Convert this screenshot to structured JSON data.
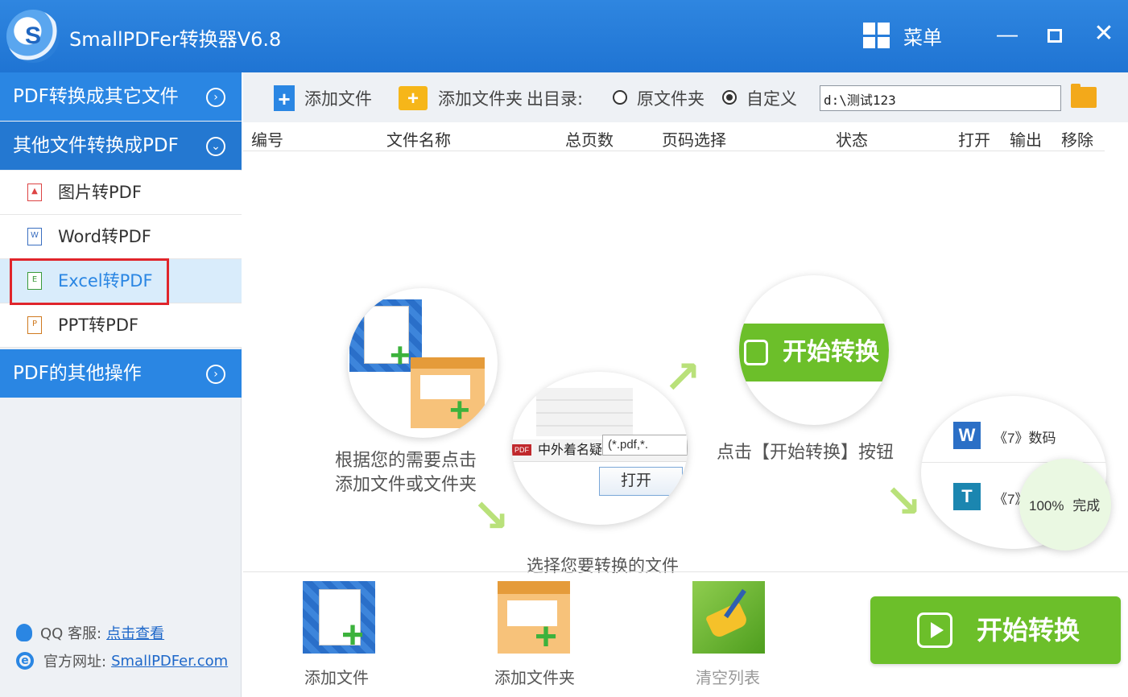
{
  "app": {
    "title": "SmallPDFer转换器V6.8",
    "menu_label": "菜单"
  },
  "window_controls": {
    "minimize": "—",
    "close": "✕"
  },
  "sidebar": {
    "sections": [
      {
        "label": "PDF转换成其它文件",
        "toggle": "›"
      },
      {
        "label": "其他文件转换成PDF",
        "toggle": "⌄"
      },
      {
        "label": "PDF的其他操作",
        "toggle": "›"
      }
    ],
    "items": [
      {
        "label": "图片转PDF",
        "icon": "image-file-icon"
      },
      {
        "label": "Word转PDF",
        "icon": "word-file-icon"
      },
      {
        "label": "Excel转PDF",
        "icon": "excel-file-icon"
      },
      {
        "label": "PPT转PDF",
        "icon": "ppt-file-icon"
      }
    ],
    "footer": {
      "qq_label": "QQ 客服:",
      "qq_link": "点击查看",
      "site_label": "官方网址:",
      "site_link": "SmallPDFer.com"
    }
  },
  "toolbar": {
    "add_file": "添加文件",
    "add_folder": "添加文件夹",
    "output_dir_label": "出目录:",
    "radio_original": "原文件夹",
    "radio_custom": "自定义",
    "output_path": "d:\\测试123"
  },
  "table": {
    "headers": [
      "编号",
      "文件名称",
      "总页数",
      "页码选择",
      "状态",
      "打开",
      "输出",
      "移除"
    ]
  },
  "guide": {
    "step1_line1": "根据您的需要点击",
    "step1_line2": "添加文件或文件夹",
    "step2": "选择您要转换的文件",
    "step3": "点击【开始转换】按钮",
    "dialog_file": "中外着名疑",
    "dialog_filter": "(*.pdf,*.",
    "dialog_open": "打开",
    "start_small": "开始转换",
    "result_row1": "《7》数码",
    "result_row2": "《7》",
    "result_progress": "100%",
    "result_done": "完成"
  },
  "bottom": {
    "add_file": "添加文件",
    "add_folder": "添加文件夹",
    "clear_list": "清空列表",
    "start": "开始转换"
  },
  "colors": {
    "title_bar": "#2a7fdc",
    "sidebar_head": "#2a86e3",
    "active_item_bg": "#d9ecfb",
    "highlight_border": "#e0252b",
    "start_button": "#6cbf2a"
  }
}
